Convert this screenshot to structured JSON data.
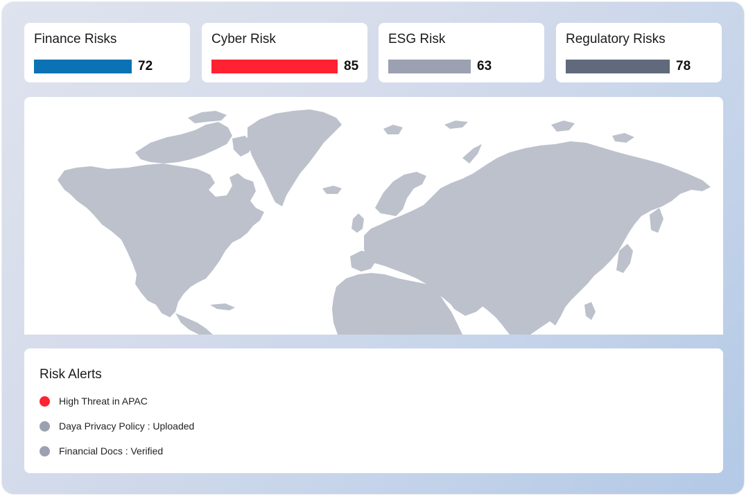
{
  "kpis": [
    {
      "title": "Finance Risks",
      "value": "72",
      "color": "#0a72b5"
    },
    {
      "title": "Cyber Risk",
      "value": "85",
      "color": "#ff2232"
    },
    {
      "title": "ESG Risk",
      "value": "63",
      "color": "#9ba1b1"
    },
    {
      "title": "Regulatory Risks",
      "value": "78",
      "color": "#606a7c"
    }
  ],
  "map": {
    "land_color": "#bcc1cc"
  },
  "alerts": {
    "title": "Risk Alerts",
    "items": [
      {
        "text": "High Threat in APAC",
        "color": "#ff2232"
      },
      {
        "text": "Daya Privacy Policy : Uploaded",
        "color": "#9ba1b1"
      },
      {
        "text": "Financial Docs : Verified",
        "color": "#9ba1b1"
      }
    ]
  }
}
